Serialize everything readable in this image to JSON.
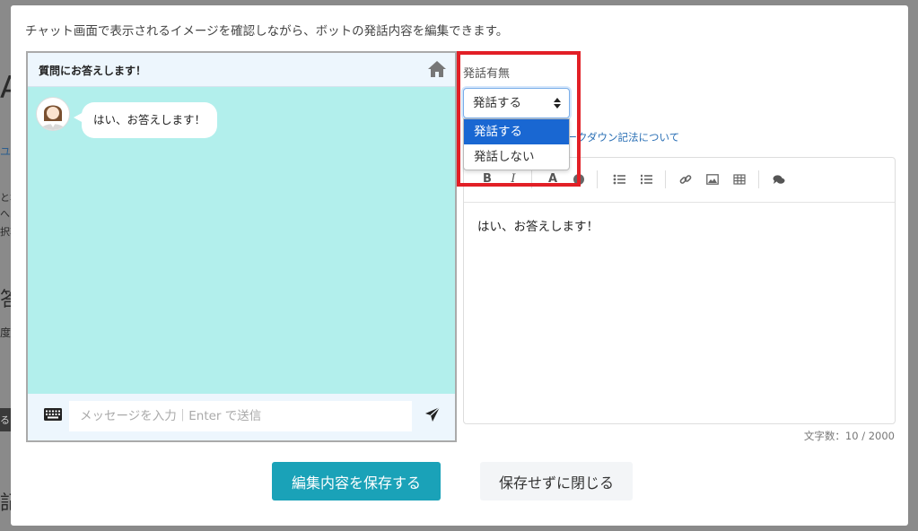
{
  "background_fragments": [
    "A",
    "ユ",
    "と場",
    "へル",
    "択項",
    "答",
    "度",
    "る",
    "記"
  ],
  "modal": {
    "intro_text": "チャット画面で表示されるイメージを確認しながら、ボットの発話内容を編集できます。"
  },
  "chat_preview": {
    "header_title": "質問にお答えします！",
    "bubble_text": "はい、お答えします！",
    "input_placeholder": "メッセージを入力｜Enter で送信",
    "icons": [
      "home-icon",
      "keyboard-icon",
      "send-icon",
      "avatar"
    ]
  },
  "speech_setting": {
    "label": "発話有無",
    "selected": "発話する",
    "options": [
      "発話する",
      "発話しない"
    ]
  },
  "editor": {
    "markdown_link": "マークダウン記法について",
    "toolbar": [
      "bold-icon",
      "italic-icon",
      "font-color-icon",
      "emoji-icon",
      "bullet-list-icon",
      "numbered-list-icon",
      "link-icon",
      "image-icon",
      "table-icon",
      "comment-icon"
    ],
    "toolbar_labels": {
      "bold": "B",
      "italic": "I",
      "font_color": "A"
    },
    "content": "はい、お答えします！",
    "char_count": "文字数：10 / 2000"
  },
  "buttons": {
    "save": "編集内容を保存する",
    "close": "保存せずに閉じる"
  },
  "colors": {
    "chat_bg": "#b2efec",
    "save_button": "#1aa2b8",
    "dropdown_selected": "#1967d2",
    "highlight": "#e21f26"
  }
}
